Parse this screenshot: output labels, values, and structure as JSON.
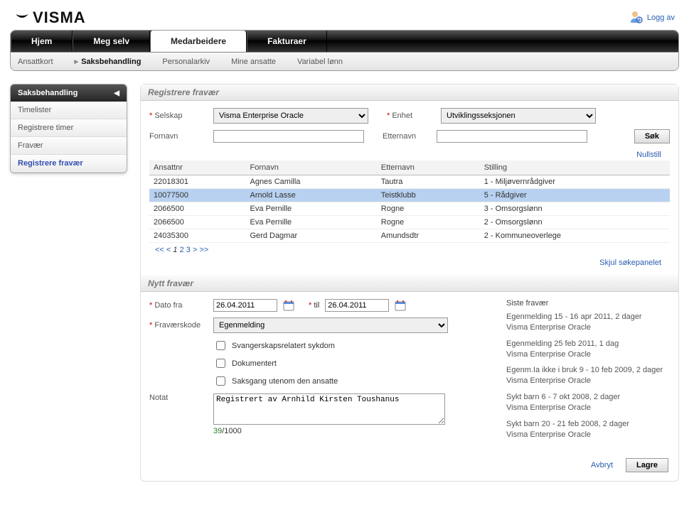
{
  "header": {
    "logo_text": "VISMA",
    "logoff_label": "Logg av"
  },
  "mainNav": {
    "tabs": [
      "Hjem",
      "Meg selv",
      "Medarbeidere",
      "Fakturaer"
    ],
    "activeIndex": 2
  },
  "subNav": {
    "items": [
      "Ansattkort",
      "Saksbehandling",
      "Personalarkiv",
      "Mine ansatte",
      "Variabel lønn"
    ],
    "activeIndex": 1
  },
  "sidebar": {
    "title": "Saksbehandling",
    "items": [
      "Timelister",
      "Registrere timer",
      "Fravær",
      "Registrere fravær"
    ],
    "activeIndex": 3
  },
  "search": {
    "sectionTitle": "Registrere fravær",
    "labels": {
      "selskap": "Selskap",
      "enhet": "Enhet",
      "fornavn": "Fornavn",
      "etternavn": "Etternavn"
    },
    "selskap_value": "Visma Enterprise Oracle",
    "enhet_value": "Utviklingsseksjonen",
    "fornavn_value": "",
    "etternavn_value": "",
    "search_btn": "Søk",
    "reset_label": "Nullstill"
  },
  "table": {
    "headers": [
      "Ansattnr",
      "Fornavn",
      "Etternavn",
      "Stilling"
    ],
    "rows": [
      {
        "nr": "22018301",
        "fn": "Agnes Camilla",
        "en": "Tautra",
        "st": "1 - Miljøvernrådgiver",
        "sel": false
      },
      {
        "nr": "10077500",
        "fn": "Arnold Lasse",
        "en": "Teistklubb",
        "st": "5 - Rådgiver",
        "sel": true
      },
      {
        "nr": "2066500",
        "fn": "Eva Pernille",
        "en": "Rogne",
        "st": "3 - Omsorgslønn",
        "sel": false
      },
      {
        "nr": "2066500",
        "fn": "Eva Pernille",
        "en": "Rogne",
        "st": "2 - Omsorgslønn",
        "sel": false
      },
      {
        "nr": "24035300",
        "fn": "Gerd Dagmar",
        "en": "Amundsdtr",
        "st": "2 - Kommuneoverlege",
        "sel": false
      }
    ],
    "pager": {
      "first": "<<",
      "prev": "<",
      "pages": [
        "1",
        "2",
        "3"
      ],
      "curIndex": 0,
      "next": ">",
      "last": ">>"
    },
    "hidePanel": "Skjul søkepanelet"
  },
  "newAbsence": {
    "sectionTitle": "Nytt fravær",
    "labels": {
      "dateFrom": "Dato fra",
      "dateTo": "til",
      "code": "Fraværskode",
      "note": "Notat"
    },
    "dateFrom": "26.04.2011",
    "dateTo": "26.04.2011",
    "code_value": "Egenmelding",
    "checkboxes": [
      "Svangerskapsrelatert sykdom",
      "Dokumentert",
      "Saksgang utenom den ansatte"
    ],
    "note_value": "Registrert av Arnhild Kirsten Toushanus",
    "counter_current": "39",
    "counter_max": "/1000",
    "recent": {
      "title": "Siste fravær",
      "items": [
        {
          "line1": "Egenmelding 15 - 16 apr 2011, 2 dager",
          "line2": "Visma Enterprise Oracle"
        },
        {
          "line1": "Egenmelding 25 feb 2011, 1 dag",
          "line2": "Visma Enterprise Oracle"
        },
        {
          "line1": "Egenm.Ia ikke i bruk 9 - 10 feb 2009, 2 dager",
          "line2": "Visma Enterprise Oracle"
        },
        {
          "line1": "Sykt barn 6 - 7 okt 2008, 2 dager",
          "line2": "Visma Enterprise Oracle"
        },
        {
          "line1": "Sykt barn 20 - 21 feb 2008, 2 dager",
          "line2": "Visma Enterprise Oracle"
        }
      ]
    },
    "cancel": "Avbryt",
    "save": "Lagre"
  }
}
